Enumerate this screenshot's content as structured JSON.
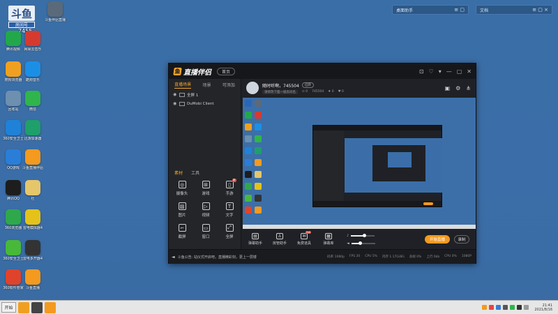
{
  "desktop": {
    "room_badge": {
      "big": "斗鱼",
      "label": "房间号",
      "number": "7455"
    },
    "icons": [
      {
        "label": "",
        "icon": "computer-icon",
        "color": "#2a66b8"
      },
      {
        "label": "",
        "icon": "app-icon",
        "color": "#e94c8a"
      },
      {
        "label": "斗鱼伴侣直播",
        "icon": "streamer-icon",
        "color": "#5a6a7a"
      },
      {
        "label": "腾讯视频",
        "icon": "play-icon",
        "color": "#22a84a"
      },
      {
        "label": "网易云音乐",
        "icon": "music-icon",
        "color": "#d63a2f"
      },
      {
        "label": "搜狗浏览器",
        "icon": "browser-icon",
        "color": "#f0a020"
      },
      {
        "label": "酷狗音乐",
        "icon": "kugou-icon",
        "color": "#1b8fe6"
      },
      {
        "label": "回收站",
        "icon": "trash-icon",
        "color": "#6d8fb0"
      },
      {
        "label": "微信",
        "icon": "wechat-icon",
        "color": "#2fb54b"
      },
      {
        "label": "360安全卫士",
        "icon": "shield-icon",
        "color": "#1f82d8"
      },
      {
        "label": "迅游加速器",
        "icon": "speed-icon",
        "color": "#1f9f6a"
      },
      {
        "label": "QQ游戏",
        "icon": "qq-game-icon",
        "color": "#2a7ed8"
      },
      {
        "label": "斗鱼直播伴侣",
        "icon": "douyu-icon",
        "color": "#f39a1f"
      },
      {
        "label": "腾讯QQ",
        "icon": "qq-icon",
        "color": "#1d1d1d"
      },
      {
        "label": "社",
        "icon": "folder-icon",
        "color": "#e5c66a"
      },
      {
        "label": "360浏览器",
        "icon": "ie-icon",
        "color": "#2fa84c"
      },
      {
        "label": "雷电模拟器4",
        "icon": "thunder-icon",
        "color": "#e4c21a"
      },
      {
        "label": "360安全卫士",
        "icon": "plus-icon",
        "color": "#48b83a"
      },
      {
        "label": "雷电多开器4",
        "icon": "multi-icon",
        "color": "#333333"
      },
      {
        "label": "360软件管家",
        "icon": "store-icon",
        "color": "#e0432c"
      },
      {
        "label": "斗鱼直播",
        "icon": "douyu2-icon",
        "color": "#f39a1f"
      }
    ],
    "widgets": [
      {
        "title": "桌面助手",
        "controls": "≡ ▢"
      },
      {
        "title": "文档",
        "controls": "≡ ▢ ×"
      }
    ]
  },
  "app": {
    "name": "直播伴侣",
    "home_label": "首页",
    "window_controls": [
      "⊡",
      "♡",
      "▾",
      "—",
      "▢",
      "✕"
    ],
    "left_tabs": [
      "直播场景",
      "场景",
      "可添加"
    ],
    "sources": [
      {
        "label": "全屏 1",
        "icon": "monitor-icon"
      },
      {
        "label": "DuMobi Client",
        "icon": "window-icon"
      }
    ],
    "bottom_tabs": [
      "素材",
      "工具"
    ],
    "tools": [
      {
        "label": "摄像头",
        "glyph": "◎",
        "hot": ""
      },
      {
        "label": "游戏",
        "glyph": "⊞",
        "hot": ""
      },
      {
        "label": "手游",
        "glyph": "▯",
        "hot": "新"
      },
      {
        "label": "图片",
        "glyph": "▨",
        "hot": ""
      },
      {
        "label": "视频",
        "glyph": "▷",
        "hot": ""
      },
      {
        "label": "文字",
        "glyph": "T",
        "hot": ""
      },
      {
        "label": "截屏",
        "glyph": "⌐",
        "hot": ""
      },
      {
        "label": "窗口",
        "glyph": "▭",
        "hot": ""
      },
      {
        "label": "全屏",
        "glyph": "⤢",
        "hot": ""
      }
    ],
    "room": {
      "title": "随时听啊，745504",
      "tag": "已开",
      "category": "请修改下面一级房间名",
      "stats": [
        "⊙ 0",
        "745504",
        "♦ 0",
        "♥ 0"
      ],
      "head_icons": [
        "▣",
        "⚙",
        "⋔"
      ]
    },
    "controls": [
      {
        "label": "弹幕助手",
        "glyph": "▤",
        "hot": ""
      },
      {
        "label": "房管助手",
        "glyph": "♙",
        "hot": ""
      },
      {
        "label": "免费道具",
        "glyph": "✉",
        "hot": "hot"
      },
      {
        "label": "弹幕库",
        "glyph": "▦",
        "hot": ""
      }
    ],
    "mic": {
      "icon": "mic-icon",
      "level": 0.55
    },
    "speaker": {
      "icon": "speaker-icon",
      "level": 0.35
    },
    "start_label": "开始直播",
    "record_label": "录制",
    "status": {
      "notice": "斗鱼公告: 站仪式开启吧，直播精彩刻，更上一层楼",
      "stats": [
        "码率 1080p",
        "FPS 30",
        "CPU 5%",
        "内存 1.17G/8G",
        "丢帧 0%",
        "上行 0kb",
        "CPU 0%",
        "1080P"
      ]
    }
  },
  "taskbar": {
    "start_label": "开始",
    "apps": [
      "#f0a020",
      "#444444",
      "#f39a1f"
    ],
    "tray": [
      "#f39a1f",
      "#e8453c",
      "#3a7bd5",
      "#555555",
      "#2fb54b",
      "#333333",
      "#999999"
    ],
    "time": "21:41",
    "date": "2021/8/16"
  }
}
